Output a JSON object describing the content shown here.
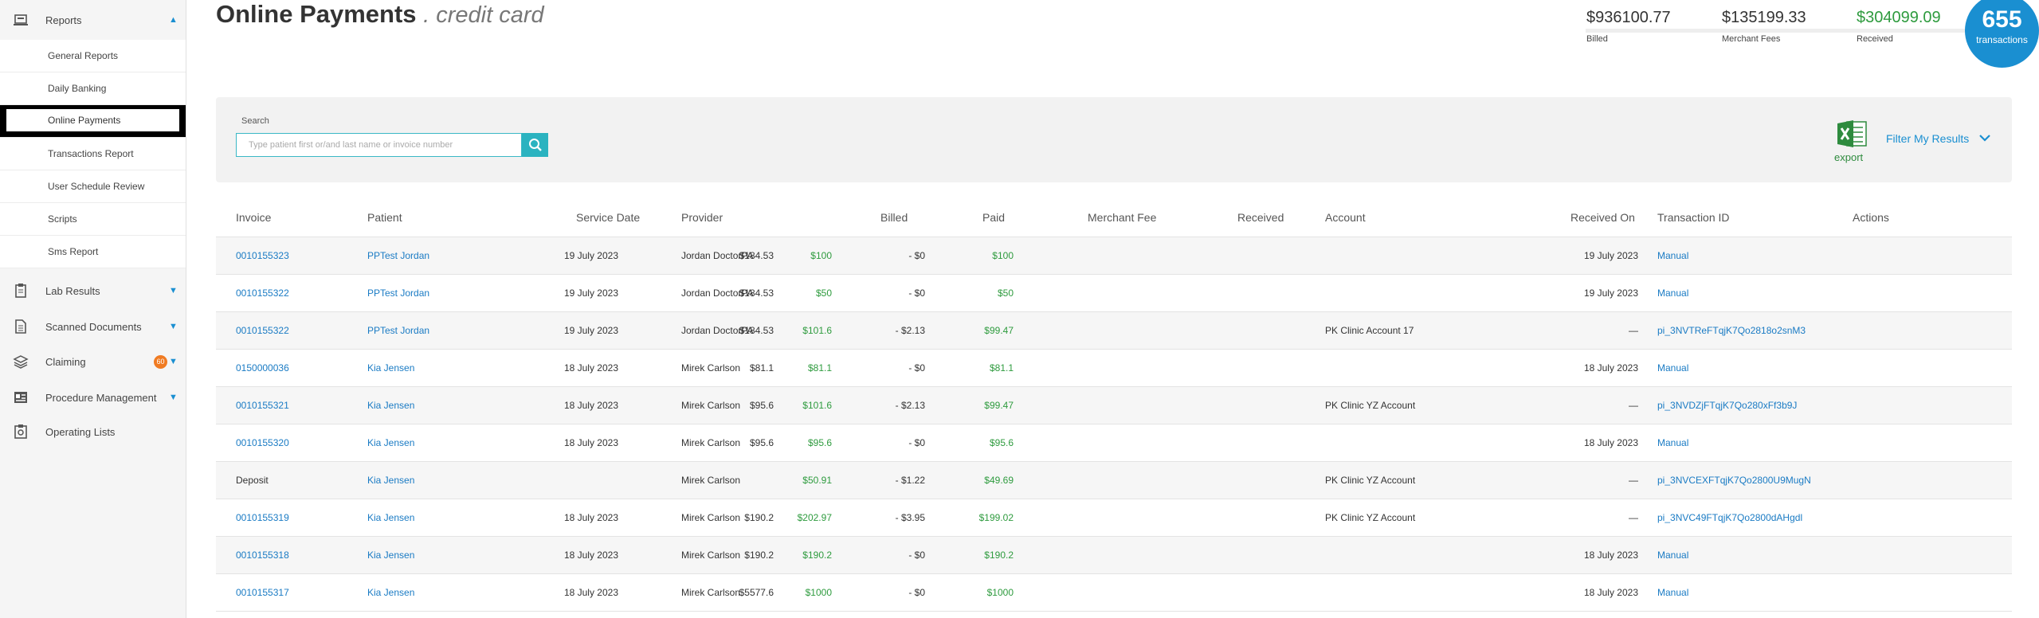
{
  "sidebar": {
    "reports": {
      "label": "Reports"
    },
    "sub_items": [
      "General Reports",
      "Daily Banking",
      "Online Payments",
      "Transactions Report",
      "User Schedule Review",
      "Scripts",
      "Sms Report"
    ],
    "lab_results": {
      "label": "Lab Results"
    },
    "scanned_documents": {
      "label": "Scanned Documents"
    },
    "claiming": {
      "label": "Claiming",
      "badge": "60"
    },
    "procedure_management": {
      "label": "Procedure Management"
    },
    "operating_lists": {
      "label": "Operating Lists"
    }
  },
  "header": {
    "title": "Online Payments",
    "subtitle": ". credit card"
  },
  "stats": {
    "billed": {
      "value": "$936100.77",
      "label": "Billed"
    },
    "merchant_fees": {
      "value": "$135199.33",
      "label": "Merchant Fees"
    },
    "received": {
      "value": "$304099.09",
      "label": "Received"
    },
    "transactions": {
      "count": "655",
      "label": "transactions"
    }
  },
  "search": {
    "label": "Search",
    "placeholder": "Type patient first or/and last name or invoice number"
  },
  "toolbar": {
    "export_label": "export",
    "filter_label": "Filter My Results"
  },
  "table": {
    "headers": {
      "invoice": "Invoice",
      "patient": "Patient",
      "service_date": "Service Date",
      "provider": "Provider",
      "billed": "Billed",
      "paid": "Paid",
      "merchant_fee": "Merchant Fee",
      "received": "Received",
      "account": "Account",
      "received_on": "Received On",
      "transaction_id": "Transaction ID",
      "actions": "Actions"
    },
    "rows": [
      {
        "invoice": "0010155323",
        "patient": "PPTest Jordan",
        "service_date": "19 July 2023",
        "provider": "Jordan DoctorPA",
        "billed": "$184.53",
        "paid": "$100",
        "merchant_fee": "- $0",
        "received": "$100",
        "account": "",
        "received_on": "19 July 2023",
        "transaction_id": "Manual"
      },
      {
        "invoice": "0010155322",
        "patient": "PPTest Jordan",
        "service_date": "19 July 2023",
        "provider": "Jordan DoctorPA",
        "billed": "$184.53",
        "paid": "$50",
        "merchant_fee": "- $0",
        "received": "$50",
        "account": "",
        "received_on": "19 July 2023",
        "transaction_id": "Manual"
      },
      {
        "invoice": "0010155322",
        "patient": "PPTest Jordan",
        "service_date": "19 July 2023",
        "provider": "Jordan DoctorPA",
        "billed": "$184.53",
        "paid": "$101.6",
        "merchant_fee": "- $2.13",
        "received": "$99.47",
        "account": "PK Clinic Account 17",
        "received_on": "—",
        "transaction_id": "pi_3NVTReFTqjK7Qo2818o2snM3"
      },
      {
        "invoice": "0150000036",
        "patient": "Kia Jensen",
        "service_date": "18 July 2023",
        "provider": "Mirek Carlson",
        "billed": "$81.1",
        "paid": "$81.1",
        "merchant_fee": "- $0",
        "received": "$81.1",
        "account": "",
        "received_on": "18 July 2023",
        "transaction_id": "Manual"
      },
      {
        "invoice": "0010155321",
        "patient": "Kia Jensen",
        "service_date": "18 July 2023",
        "provider": "Mirek Carlson",
        "billed": "$95.6",
        "paid": "$101.6",
        "merchant_fee": "- $2.13",
        "received": "$99.47",
        "account": "PK Clinic YZ Account",
        "received_on": "—",
        "transaction_id": "pi_3NVDZjFTqjK7Qo280xFf3b9J"
      },
      {
        "invoice": "0010155320",
        "patient": "Kia Jensen",
        "service_date": "18 July 2023",
        "provider": "Mirek Carlson",
        "billed": "$95.6",
        "paid": "$95.6",
        "merchant_fee": "- $0",
        "received": "$95.6",
        "account": "",
        "received_on": "18 July 2023",
        "transaction_id": "Manual"
      },
      {
        "invoice": "Deposit",
        "patient": "Kia Jensen",
        "service_date": "",
        "provider": "Mirek Carlson",
        "billed": "",
        "paid": "$50.91",
        "merchant_fee": "- $1.22",
        "received": "$49.69",
        "account": "PK Clinic YZ Account",
        "received_on": "—",
        "transaction_id": "pi_3NVCEXFTqjK7Qo2800U9MugN"
      },
      {
        "invoice": "0010155319",
        "patient": "Kia Jensen",
        "service_date": "18 July 2023",
        "provider": "Mirek Carlson",
        "billed": "$190.2",
        "paid": "$202.97",
        "merchant_fee": "- $3.95",
        "received": "$199.02",
        "account": "PK Clinic YZ Account",
        "received_on": "—",
        "transaction_id": "pi_3NVC49FTqjK7Qo2800dAHgdl"
      },
      {
        "invoice": "0010155318",
        "patient": "Kia Jensen",
        "service_date": "18 July 2023",
        "provider": "Mirek Carlson",
        "billed": "$190.2",
        "paid": "$190.2",
        "merchant_fee": "- $0",
        "received": "$190.2",
        "account": "",
        "received_on": "18 July 2023",
        "transaction_id": "Manual"
      },
      {
        "invoice": "0010155317",
        "patient": "Kia Jensen",
        "service_date": "18 July 2023",
        "provider": "Mirek Carlson",
        "billed": "$5577.6",
        "paid": "$1000",
        "merchant_fee": "- $0",
        "received": "$1000",
        "account": "",
        "received_on": "18 July 2023",
        "transaction_id": "Manual"
      }
    ]
  },
  "colors": {
    "accent": "#1a8fd1",
    "green": "#2e9b3e",
    "teal": "#2bb3c0",
    "badge": "#f07b22"
  }
}
